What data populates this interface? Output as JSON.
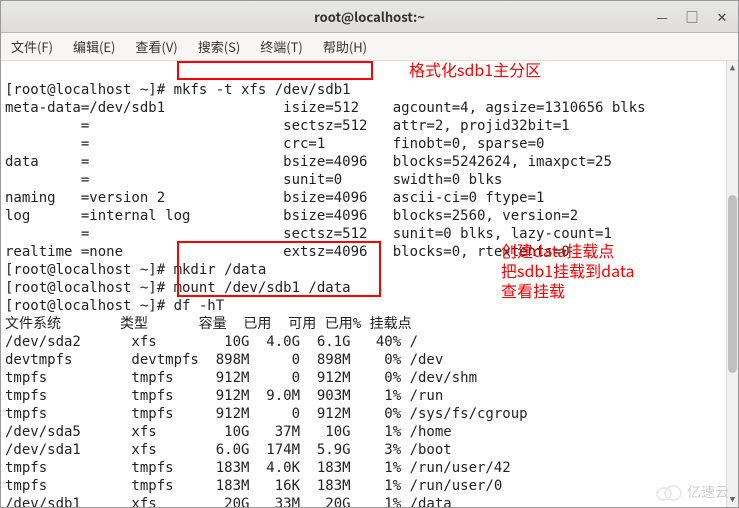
{
  "window": {
    "title": "root@localhost:~",
    "controls": {
      "min": "—",
      "max": "□",
      "close": "✕"
    }
  },
  "menubar": {
    "file": "文件(F)",
    "edit": "编辑(E)",
    "view": "查看(V)",
    "search": "搜索(S)",
    "terminal": "终端(T)",
    "help": "帮助(H)"
  },
  "annotations": {
    "a1": "格式化sdb1主分区",
    "a2": "创建data挂载点",
    "a3": "把sdb1挂载到data",
    "a4": "查看挂载"
  },
  "term": {
    "l01": "[root@localhost ~]# mkfs -t xfs /dev/sdb1",
    "l02": "meta-data=/dev/sdb1              isize=512    agcount=4, agsize=1310656 blks",
    "l03": "         =                       sectsz=512   attr=2, projid32bit=1",
    "l04": "         =                       crc=1        finobt=0, sparse=0",
    "l05": "data     =                       bsize=4096   blocks=5242624, imaxpct=25",
    "l06": "         =                       sunit=0      swidth=0 blks",
    "l07": "naming   =version 2              bsize=4096   ascii-ci=0 ftype=1",
    "l08": "log      =internal log           bsize=4096   blocks=2560, version=2",
    "l09": "         =                       sectsz=512   sunit=0 blks, lazy-count=1",
    "l10": "realtime =none                   extsz=4096   blocks=0, rtextents=0",
    "l11": "[root@localhost ~]# mkdir /data",
    "l12": "[root@localhost ~]# mount /dev/sdb1 /data",
    "l13": "[root@localhost ~]# df -hT",
    "l14": "文件系统       类型      容量  已用  可用 已用% 挂载点",
    "l15": "/dev/sda2      xfs        10G  4.0G  6.1G   40% /",
    "l16": "devtmpfs       devtmpfs  898M     0  898M    0% /dev",
    "l17": "tmpfs          tmpfs     912M     0  912M    0% /dev/shm",
    "l18": "tmpfs          tmpfs     912M  9.0M  903M    1% /run",
    "l19": "tmpfs          tmpfs     912M     0  912M    0% /sys/fs/cgroup",
    "l20": "/dev/sda5      xfs        10G   37M   10G    1% /home",
    "l21": "/dev/sda1      xfs       6.0G  174M  5.9G    3% /boot",
    "l22": "tmpfs          tmpfs     183M  4.0K  183M    1% /run/user/42",
    "l23": "tmpfs          tmpfs     183M   16K  183M    1% /run/user/0",
    "l24": "/dev/sdb1      xfs        20G   33M   20G    1% /data"
  },
  "watermark": {
    "text": "亿速云"
  }
}
